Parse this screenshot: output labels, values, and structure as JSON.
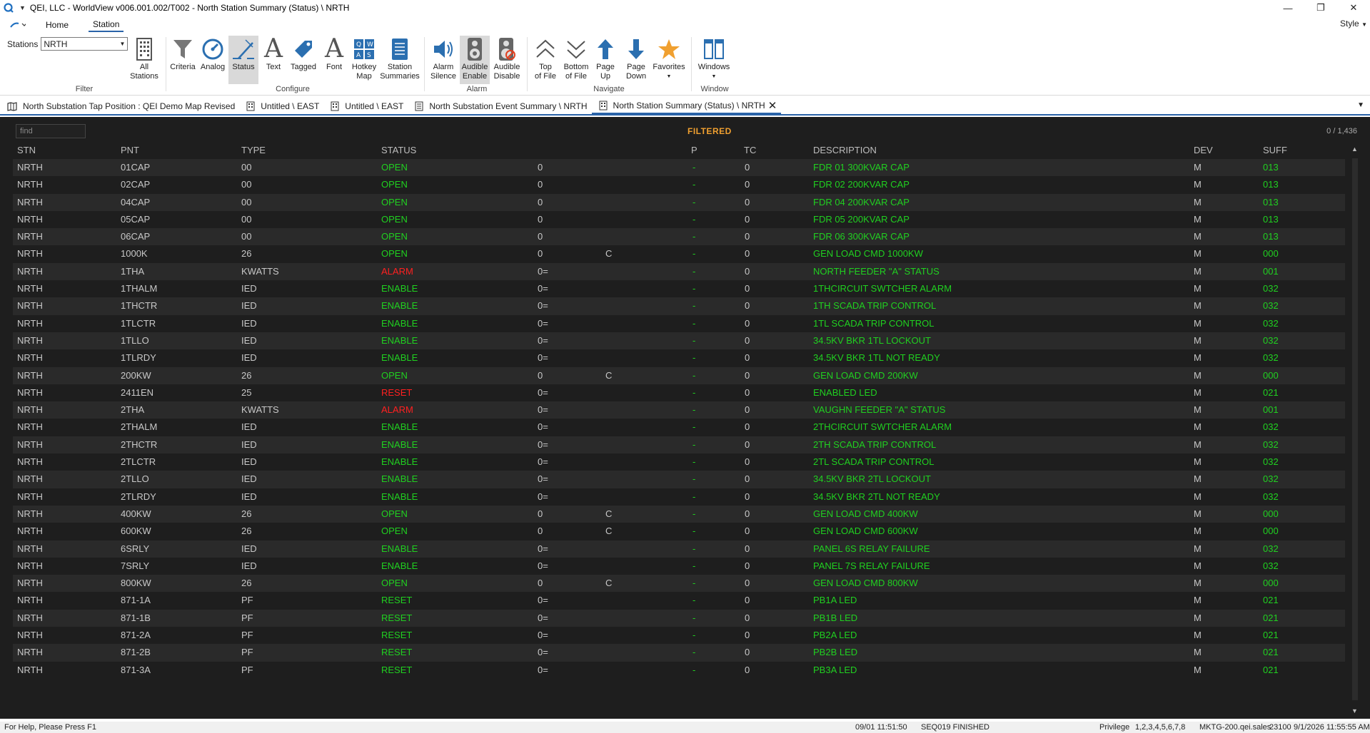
{
  "window": {
    "title": "QEI, LLC - WorldView v006.001.002/T002 - North Station Summary (Status) \\ NRTH",
    "minimize": "—",
    "maximize": "❐",
    "close": "✕"
  },
  "menu": {
    "tabs": [
      "Home",
      "Station"
    ],
    "active": "Station",
    "style": "Style"
  },
  "ribbon": {
    "stations_label": "Stations",
    "stations_value": "NRTH",
    "filter": {
      "label": "Filter",
      "all_stations": [
        "All",
        "Stations"
      ]
    },
    "configure": {
      "label": "Configure",
      "criteria": "Criteria",
      "analog": "Analog",
      "status": "Status",
      "text": "Text",
      "tagged": "Tagged",
      "font": "Font",
      "hotkey_map": [
        "Hotkey",
        "Map"
      ],
      "station_summaries": [
        "Station",
        "Summaries"
      ]
    },
    "alarm": {
      "label": "Alarm",
      "alarm_silence": [
        "Alarm",
        "Silence"
      ],
      "audible_enable": [
        "Audible",
        "Enable"
      ],
      "audible_disable": [
        "Audible",
        "Disable"
      ]
    },
    "navigate": {
      "label": "Navigate",
      "top_of_file": [
        "Top",
        "of File"
      ],
      "bottom_of_file": [
        "Bottom",
        "of File"
      ],
      "page_up": [
        "Page",
        "Up"
      ],
      "page_down": [
        "Page",
        "Down"
      ],
      "favorites": "Favorites"
    },
    "window": {
      "label": "Window",
      "windows": "Windows"
    }
  },
  "doc_tabs": [
    {
      "label": "North Substation Tap Position : QEI Demo Map Revised",
      "icon": "map-icon"
    },
    {
      "label": "Untitled \\ EAST",
      "icon": "grid-icon"
    },
    {
      "label": "Untitled \\ EAST",
      "icon": "grid-icon"
    },
    {
      "label": "North Substation Event Summary \\ NRTH",
      "icon": "list-icon"
    },
    {
      "label": "North Station Summary (Status) \\ NRTH",
      "icon": "grid-icon",
      "active": true
    }
  ],
  "grid": {
    "find_placeholder": "find",
    "filtered": "FILTERED",
    "count": "0 / 1,436",
    "headers": {
      "stn": "STN",
      "pnt": "PNT",
      "type": "TYPE",
      "status": "STATUS",
      "p": "P",
      "tc": "TC",
      "description": "DESCRIPTION",
      "dev": "DEV",
      "suff": "SUFF"
    },
    "rows": [
      [
        "NRTH",
        "01CAP",
        "00",
        "OPEN",
        "0",
        "",
        "-",
        "0",
        "FDR 01 300KVAR CAP",
        "M",
        "013"
      ],
      [
        "NRTH",
        "02CAP",
        "00",
        "OPEN",
        "0",
        "",
        "-",
        "0",
        "FDR 02 200KVAR CAP",
        "M",
        "013"
      ],
      [
        "NRTH",
        "04CAP",
        "00",
        "OPEN",
        "0",
        "",
        "-",
        "0",
        "FDR 04 200KVAR CAP",
        "M",
        "013"
      ],
      [
        "NRTH",
        "05CAP",
        "00",
        "OPEN",
        "0",
        "",
        "-",
        "0",
        "FDR 05 200KVAR CAP",
        "M",
        "013"
      ],
      [
        "NRTH",
        "06CAP",
        "00",
        "OPEN",
        "0",
        "",
        "-",
        "0",
        "FDR 06 300KVAR CAP",
        "M",
        "013"
      ],
      [
        "NRTH",
        "1000K",
        "26",
        "OPEN",
        "0",
        "C",
        "-",
        "0",
        "GEN LOAD CMD 1000KW",
        "M",
        "000"
      ],
      [
        "NRTH",
        "1THA",
        "KWATTS",
        "ALARM",
        "0=",
        "",
        "-",
        "0",
        "NORTH FEEDER \"A\" STATUS",
        "M",
        "001"
      ],
      [
        "NRTH",
        "1THALM",
        "IED",
        "ENABLE",
        "0=",
        "",
        "-",
        "0",
        "1THCIRCUIT SWTCHER ALARM",
        "M",
        "032"
      ],
      [
        "NRTH",
        "1THCTR",
        "IED",
        "ENABLE",
        "0=",
        "",
        "-",
        "0",
        "1TH SCADA TRIP CONTROL",
        "M",
        "032"
      ],
      [
        "NRTH",
        "1TLCTR",
        "IED",
        "ENABLE",
        "0=",
        "",
        "-",
        "0",
        "1TL SCADA TRIP CONTROL",
        "M",
        "032"
      ],
      [
        "NRTH",
        "1TLLO",
        "IED",
        "ENABLE",
        "0=",
        "",
        "-",
        "0",
        "34.5KV BKR 1TL LOCKOUT",
        "M",
        "032"
      ],
      [
        "NRTH",
        "1TLRDY",
        "IED",
        "ENABLE",
        "0=",
        "",
        "-",
        "0",
        "34.5KV BKR 1TL NOT READY",
        "M",
        "032"
      ],
      [
        "NRTH",
        "200KW",
        "26",
        "OPEN",
        "0",
        "C",
        "-",
        "0",
        "GEN LOAD CMD 200KW",
        "M",
        "000"
      ],
      [
        "NRTH",
        "2411EN",
        "25",
        "RESET",
        "0=",
        "",
        "-",
        "0",
        "ENABLED LED",
        "M",
        "021"
      ],
      [
        "NRTH",
        "2THA",
        "KWATTS",
        "ALARM",
        "0=",
        "",
        "-",
        "0",
        "VAUGHN FEEDER \"A\" STATUS",
        "M",
        "001"
      ],
      [
        "NRTH",
        "2THALM",
        "IED",
        "ENABLE",
        "0=",
        "",
        "-",
        "0",
        "2THCIRCUIT SWTCHER ALARM",
        "M",
        "032"
      ],
      [
        "NRTH",
        "2THCTR",
        "IED",
        "ENABLE",
        "0=",
        "",
        "-",
        "0",
        "2TH SCADA TRIP CONTROL",
        "M",
        "032"
      ],
      [
        "NRTH",
        "2TLCTR",
        "IED",
        "ENABLE",
        "0=",
        "",
        "-",
        "0",
        "2TL SCADA TRIP CONTROL",
        "M",
        "032"
      ],
      [
        "NRTH",
        "2TLLO",
        "IED",
        "ENABLE",
        "0=",
        "",
        "-",
        "0",
        "34.5KV BKR 2TL LOCKOUT",
        "M",
        "032"
      ],
      [
        "NRTH",
        "2TLRDY",
        "IED",
        "ENABLE",
        "0=",
        "",
        "-",
        "0",
        "34.5KV BKR 2TL NOT READY",
        "M",
        "032"
      ],
      [
        "NRTH",
        "400KW",
        "26",
        "OPEN",
        "0",
        "C",
        "-",
        "0",
        "GEN LOAD CMD 400KW",
        "M",
        "000"
      ],
      [
        "NRTH",
        "600KW",
        "26",
        "OPEN",
        "0",
        "C",
        "-",
        "0",
        "GEN LOAD CMD 600KW",
        "M",
        "000"
      ],
      [
        "NRTH",
        "6SRLY",
        "IED",
        "ENABLE",
        "0=",
        "",
        "-",
        "0",
        "PANEL 6S RELAY FAILURE",
        "M",
        "032"
      ],
      [
        "NRTH",
        "7SRLY",
        "IED",
        "ENABLE",
        "0=",
        "",
        "-",
        "0",
        "PANEL 7S RELAY FAILURE",
        "M",
        "032"
      ],
      [
        "NRTH",
        "800KW",
        "26",
        "OPEN",
        "0",
        "C",
        "-",
        "0",
        "GEN LOAD CMD 800KW",
        "M",
        "000"
      ],
      [
        "NRTH",
        "871-1A",
        "PF",
        "RESET",
        "0=",
        "",
        "-",
        "0",
        "PB1A LED",
        "M",
        "021"
      ],
      [
        "NRTH",
        "871-1B",
        "PF",
        "RESET",
        "0=",
        "",
        "-",
        "0",
        "PB1B LED",
        "M",
        "021"
      ],
      [
        "NRTH",
        "871-2A",
        "PF",
        "RESET",
        "0=",
        "",
        "-",
        "0",
        "PB2A LED",
        "M",
        "021"
      ],
      [
        "NRTH",
        "871-2B",
        "PF",
        "RESET",
        "0=",
        "",
        "-",
        "0",
        "PB2B LED",
        "M",
        "021"
      ],
      [
        "NRTH",
        "871-3A",
        "PF",
        "RESET",
        "0=",
        "",
        "-",
        "0",
        "PB3A LED",
        "M",
        "021"
      ]
    ],
    "red_status_rows": [
      6,
      13,
      14
    ]
  },
  "statusbar": {
    "help": "For Help, Please Press F1",
    "datetime": "09/01 11:51:50",
    "seq": "SEQ019 FINISHED",
    "privilege_label": "Privilege",
    "privilege_value": "1,2,3,4,5,6,7,8",
    "host": "MKTG-200.qei.sales",
    "port": "23100",
    "clock": "9/1/2026 11:55:55 AM"
  },
  "colors": {
    "ok_green": "#20d020",
    "alarm_red": "#ff2020",
    "filtered_orange": "#f0a030",
    "accent_blue": "#2a63a8",
    "grid_bg": "#1e1e1e"
  }
}
